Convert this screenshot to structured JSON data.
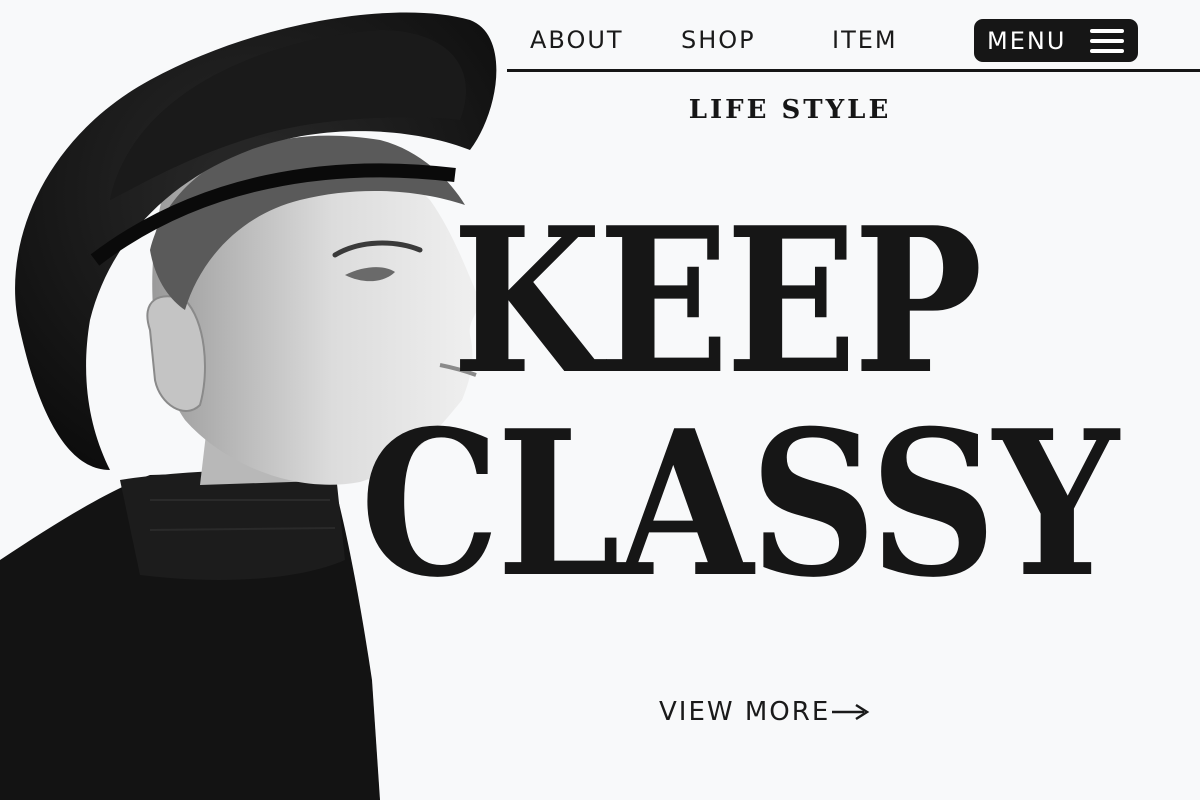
{
  "nav": {
    "links": [
      "ABOUT",
      "SHOP",
      "ITEM"
    ],
    "menu_label": "MENU"
  },
  "hero": {
    "eyebrow": "LIFE STYLE",
    "headline_line1": "KEEP",
    "headline_line2": "CLASSY",
    "cta_label": "VIEW MORE"
  },
  "icons": {
    "menu": "hamburger-icon",
    "cta": "arrow-right-icon"
  },
  "colors": {
    "background": "#f8f9fa",
    "ink": "#161616",
    "menu_bg": "#161616",
    "menu_text": "#ffffff"
  }
}
